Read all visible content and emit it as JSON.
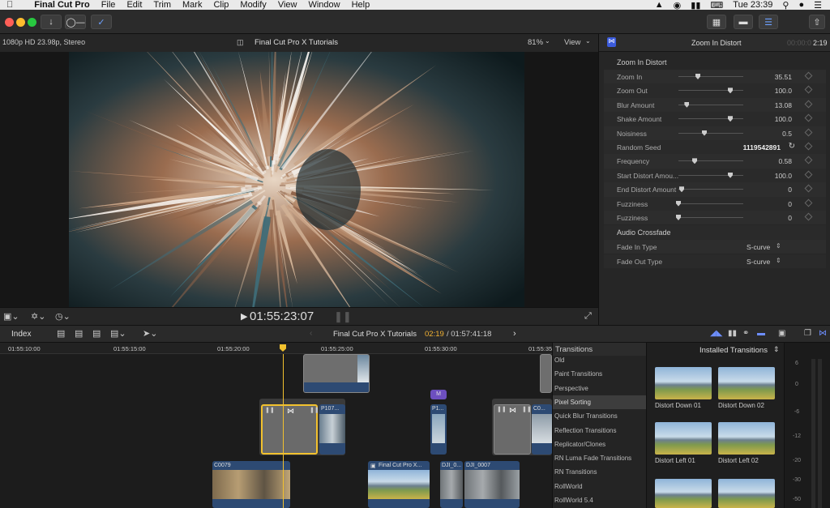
{
  "menubar": {
    "app": "Final Cut Pro",
    "items": [
      "File",
      "Edit",
      "Trim",
      "Mark",
      "Clip",
      "Modify",
      "View",
      "Window",
      "Help"
    ],
    "clock": "Tue 23:39"
  },
  "viewer": {
    "format": "1080p HD 23.98p, Stereo",
    "project": "Final Cut Pro X Tutorials",
    "zoom": "81%",
    "view_label": "View",
    "timecode": "01:55:23:07"
  },
  "inspector": {
    "title": "Zoom In Distort",
    "time_dim": "00:00:0",
    "time": "2:19",
    "section": "Zoom In Distort",
    "params": [
      {
        "label": "Zoom In",
        "value": "35.51",
        "pos": 0.3
      },
      {
        "label": "Zoom Out",
        "value": "100.0",
        "pos": 0.8
      },
      {
        "label": "Blur Amount",
        "value": "13.08",
        "pos": 0.13
      },
      {
        "label": "Shake Amount",
        "value": "100.0",
        "pos": 0.8
      },
      {
        "label": "Noisiness",
        "value": "0.5",
        "pos": 0.4
      },
      {
        "label": "Random Seed",
        "value": "1119542891",
        "pos": null
      },
      {
        "label": "Frequency",
        "value": "0.58",
        "pos": 0.25
      },
      {
        "label": "Start Distort Amou...",
        "value": "100.0",
        "pos": 0.8
      },
      {
        "label": "End Distort Amount",
        "value": "0",
        "pos": 0.05
      },
      {
        "label": "Fuzziness",
        "value": "0",
        "pos": 0.0
      },
      {
        "label": "Fuzziness",
        "value": "0",
        "pos": 0.0
      }
    ],
    "audio_section": "Audio Crossfade",
    "audio": [
      {
        "label": "Fade In Type",
        "value": "S-curve"
      },
      {
        "label": "Fade Out Type",
        "value": "S-curve"
      }
    ]
  },
  "timeline": {
    "index_label": "Index",
    "project": "Final Cut Pro X Tutorials",
    "current": "02:19",
    "total": "/ 01:57:41:18",
    "ruler": [
      "01:55:10:00",
      "01:55:15:00",
      "01:55:20:00",
      "01:55:25:00",
      "01:55:30:00",
      "01:55:35:00"
    ],
    "clips": {
      "p107": "P107...",
      "p1": "P1...",
      "c0": "C0...",
      "c0079": "C0079",
      "fcp": "Final Cut Pro X...",
      "dji0": "DJI_0...",
      "dji7": "DJI_0007",
      "m": "M"
    }
  },
  "transitions": {
    "header": "Transitions",
    "installed": "Installed Transitions",
    "items": [
      "Old",
      "Paint Transitions",
      "Perspective",
      "Pixel Sorting",
      "Quick Blur Transitions",
      "Reflection Transitions",
      "Replicator/Clones",
      "RN Luma Fade Transitions",
      "RN Transitions",
      "RollWorld",
      "RollWorld 5.4"
    ],
    "selected": 3,
    "thumbs": [
      "Distort Down 01",
      "Distort Down 02",
      "Distort Left 01",
      "Distort Left 02"
    ]
  },
  "meter": {
    "ticks": [
      "6",
      "0",
      "-6",
      "-12",
      "-20",
      "-30",
      "-50"
    ]
  }
}
